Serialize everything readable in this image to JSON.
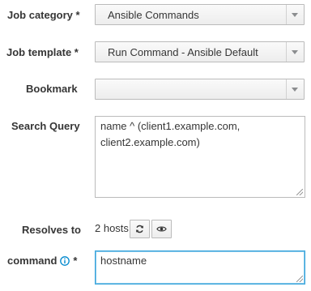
{
  "job_category": {
    "label": "Job category *",
    "value": "Ansible Commands"
  },
  "job_template": {
    "label": "Job template *",
    "value": "Run Command - Ansible Default"
  },
  "bookmark": {
    "label": "Bookmark",
    "value": ""
  },
  "search_query": {
    "label": "Search Query",
    "line1": "name ^ (client1.example.com,",
    "line2": "client2.example.com)"
  },
  "resolves_to": {
    "label": "Resolves to",
    "hosts_text": "2 hosts"
  },
  "command": {
    "label": "command",
    "required_mark": "*",
    "value": "hostname"
  },
  "icons": {
    "refresh": "refresh-icon",
    "preview": "eye-icon",
    "info": "info-circle-icon",
    "dropdown": "caret-down-icon"
  },
  "colors": {
    "focus_border": "#39a5dc",
    "info_icon": "#0088ce"
  }
}
